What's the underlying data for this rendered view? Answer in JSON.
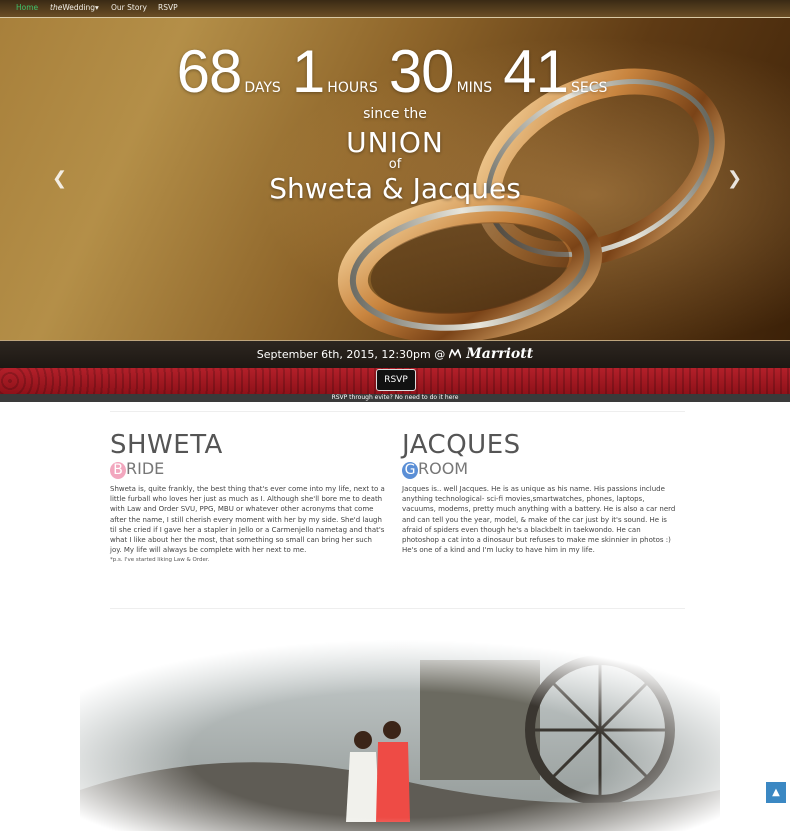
{
  "nav": {
    "home": "Home",
    "wedding_prefix": "the",
    "wedding": "Wedding",
    "wedding_caret": "▾",
    "story": "Our Story",
    "rsvp": "RSVP"
  },
  "hero": {
    "days": "68",
    "days_label": "DAYS",
    "hours": "1",
    "hours_label": "HOURS",
    "mins": "30",
    "mins_label": "MINS",
    "secs": "41",
    "secs_label": "SECS",
    "since": "since the",
    "union": "UNION",
    "of": "of",
    "names": "Shweta & Jacques",
    "prev_icon": "chevron-left-icon",
    "next_icon": "chevron-right-icon",
    "slide_count": 4,
    "active_slide": 3
  },
  "event": {
    "date": "September 6th, 2015, 12:30pm @",
    "venue": "Marriott"
  },
  "rsvp": {
    "button": "RSVP",
    "note": "RSVP through evite? No need to do it here"
  },
  "bride": {
    "name": "SHWETA",
    "role_initial": "B",
    "role_rest": "RIDE",
    "bio": "Shweta is, quite frankly, the best thing that's ever come into my life, next to a little furball who loves her just as much as I. Although she'll bore me to death with Law and Order SVU, PPG, MBU or whatever other acronyms that come after the name, I still cherish every moment with her by my side. She'd laugh til she cried if I gave her a stapler in Jello or a Carmenjello nametag and that's what I like about her the most, that something so small can bring her such joy. My life will always be complete with her next to me.",
    "ps": "*p.s. I've started liking Law & Order."
  },
  "groom": {
    "name": "JACQUES",
    "role_initial": "G",
    "role_rest": "ROOM",
    "bio": "Jacques is.. well Jacques. He is as unique as his name. His passions include anything technological- sci-fi movies,smartwatches, phones, laptops, vacuums, modems, pretty much anything with a battery. He is also a car nerd and can tell you the year, model, & make of the car just by it's sound. He is afraid of spiders even though he's a blackbelt in taekwondo. He can photoshop a cat into a dinosaur but refuses to make me skinnier in photos :) He's one of a kind and I'm lucky to have him in my life."
  },
  "colors": {
    "bride_accent": "#f2a7be",
    "groom_accent": "#5b8fd6",
    "band_red": "#a3161f",
    "scroll_button": "#3b88c3"
  },
  "scroll_top_icon": "chevron-up-icon"
}
